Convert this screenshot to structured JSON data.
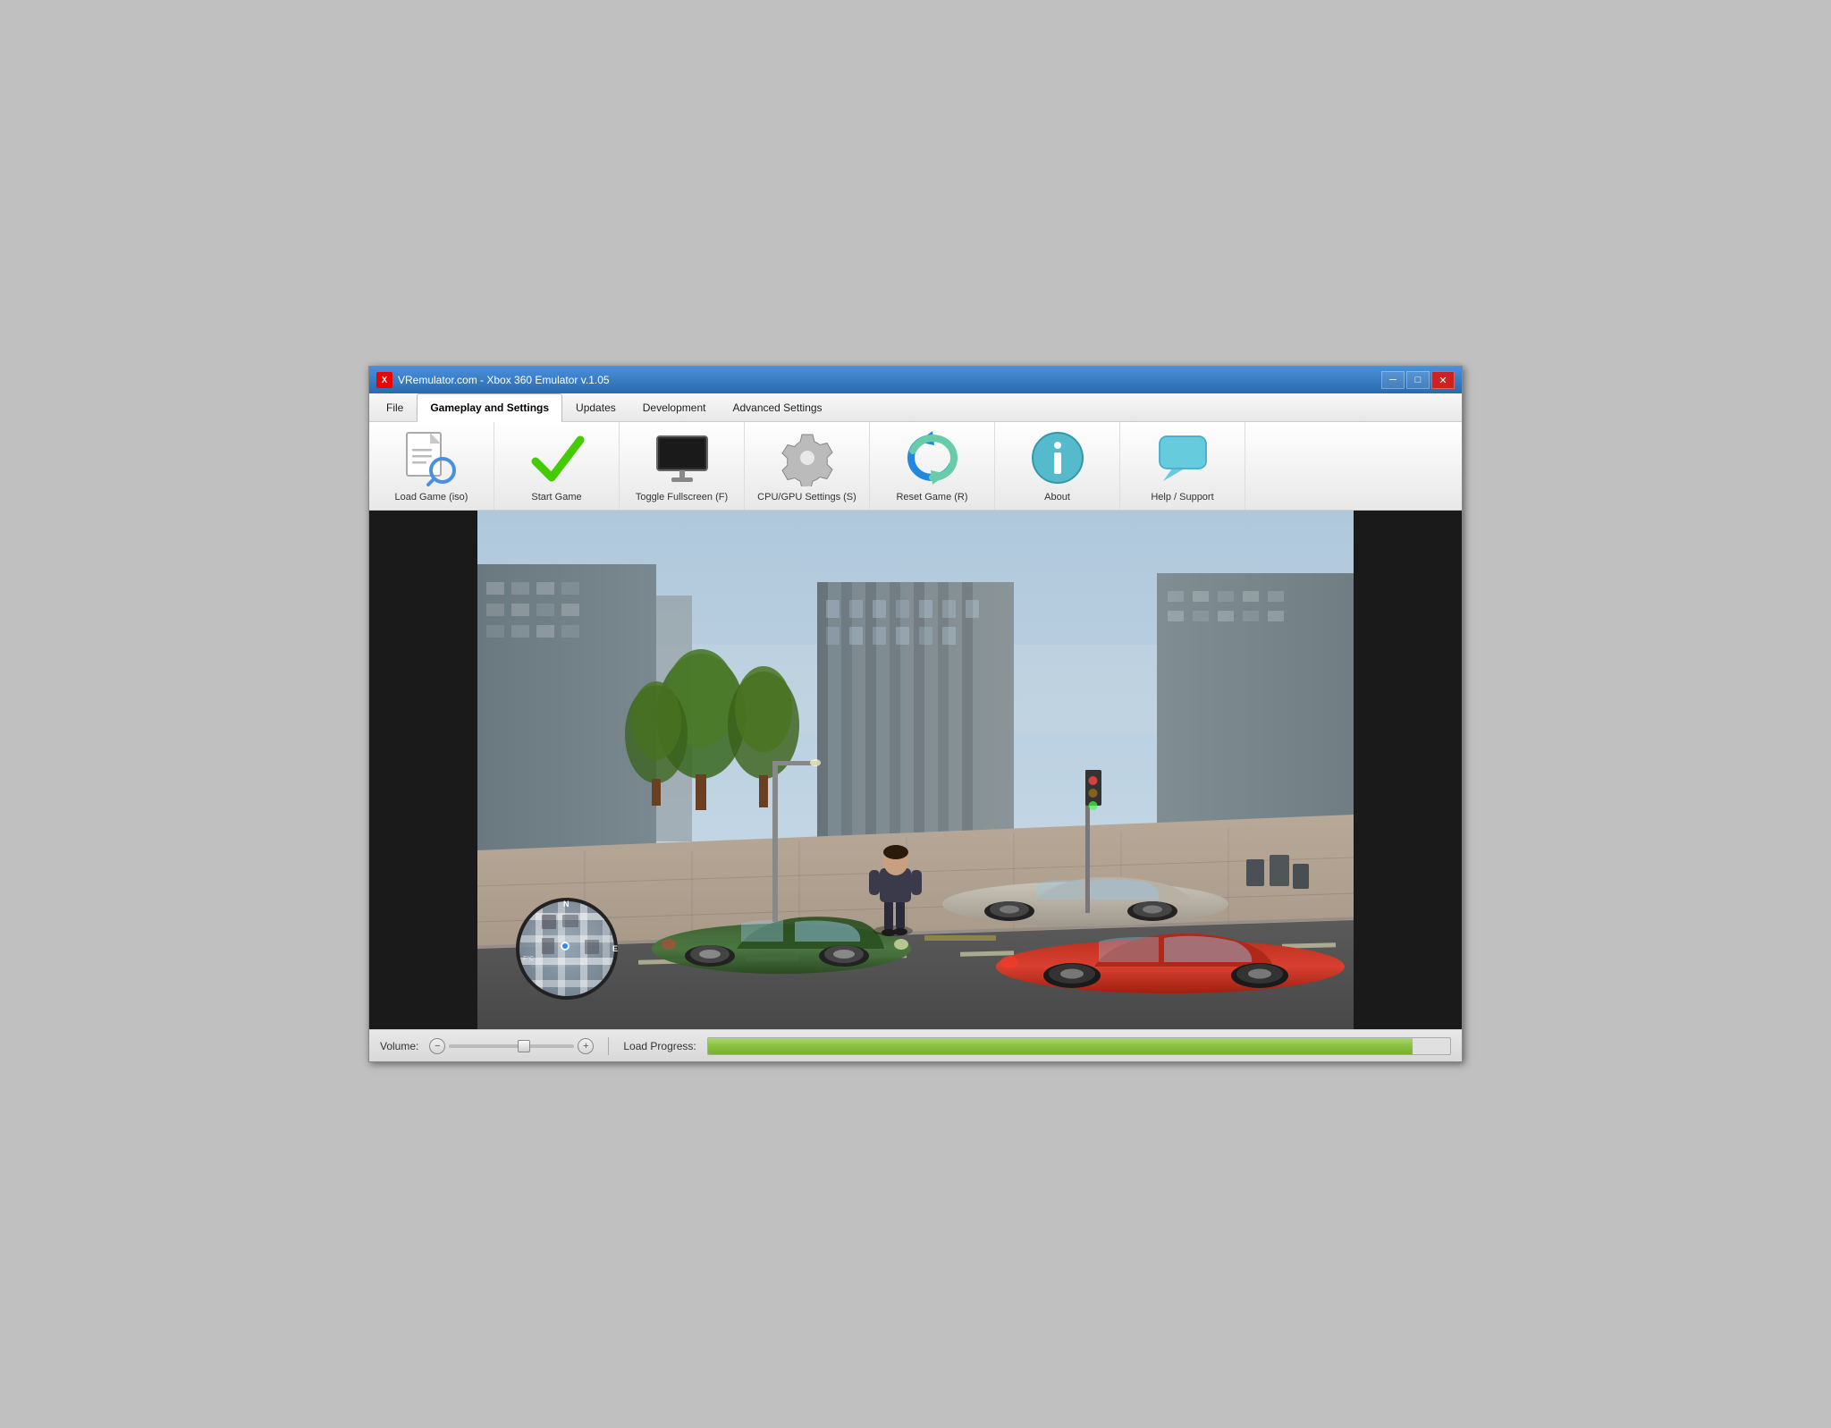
{
  "window": {
    "title": "VRemulator.com - Xbox 360 Emulator v.1.05",
    "icon_label": "X"
  },
  "titlebar": {
    "minimize_label": "─",
    "maximize_label": "□",
    "close_label": "✕"
  },
  "menu": {
    "items": [
      {
        "id": "file",
        "label": "File",
        "active": false
      },
      {
        "id": "gameplay",
        "label": "Gameplay and Settings",
        "active": true
      },
      {
        "id": "updates",
        "label": "Updates",
        "active": false
      },
      {
        "id": "development",
        "label": "Development",
        "active": false
      },
      {
        "id": "advanced",
        "label": "Advanced Settings",
        "active": false
      }
    ]
  },
  "toolbar": {
    "buttons": [
      {
        "id": "load-game",
        "label": "Load Game (iso)"
      },
      {
        "id": "start-game",
        "label": "Start Game"
      },
      {
        "id": "toggle-fullscreen",
        "label": "Toggle Fullscreen (F)"
      },
      {
        "id": "cpu-gpu-settings",
        "label": "CPU/GPU Settings (S)"
      },
      {
        "id": "reset-game",
        "label": "Reset Game (R)"
      },
      {
        "id": "about",
        "label": "About"
      },
      {
        "id": "help-support",
        "label": "Help / Support"
      }
    ]
  },
  "statusbar": {
    "volume_label": "Volume:",
    "vol_minus": "−",
    "vol_plus": "+",
    "progress_label": "Load Progress:",
    "progress_value": 95,
    "volume_level": 60
  },
  "icons": {
    "load_game": "document-search-icon",
    "start_game": "checkmark-icon",
    "fullscreen": "monitor-icon",
    "cpu_gpu": "gear-icon",
    "reset": "reset-arrows-icon",
    "about": "info-icon",
    "help": "chat-bubble-icon"
  }
}
